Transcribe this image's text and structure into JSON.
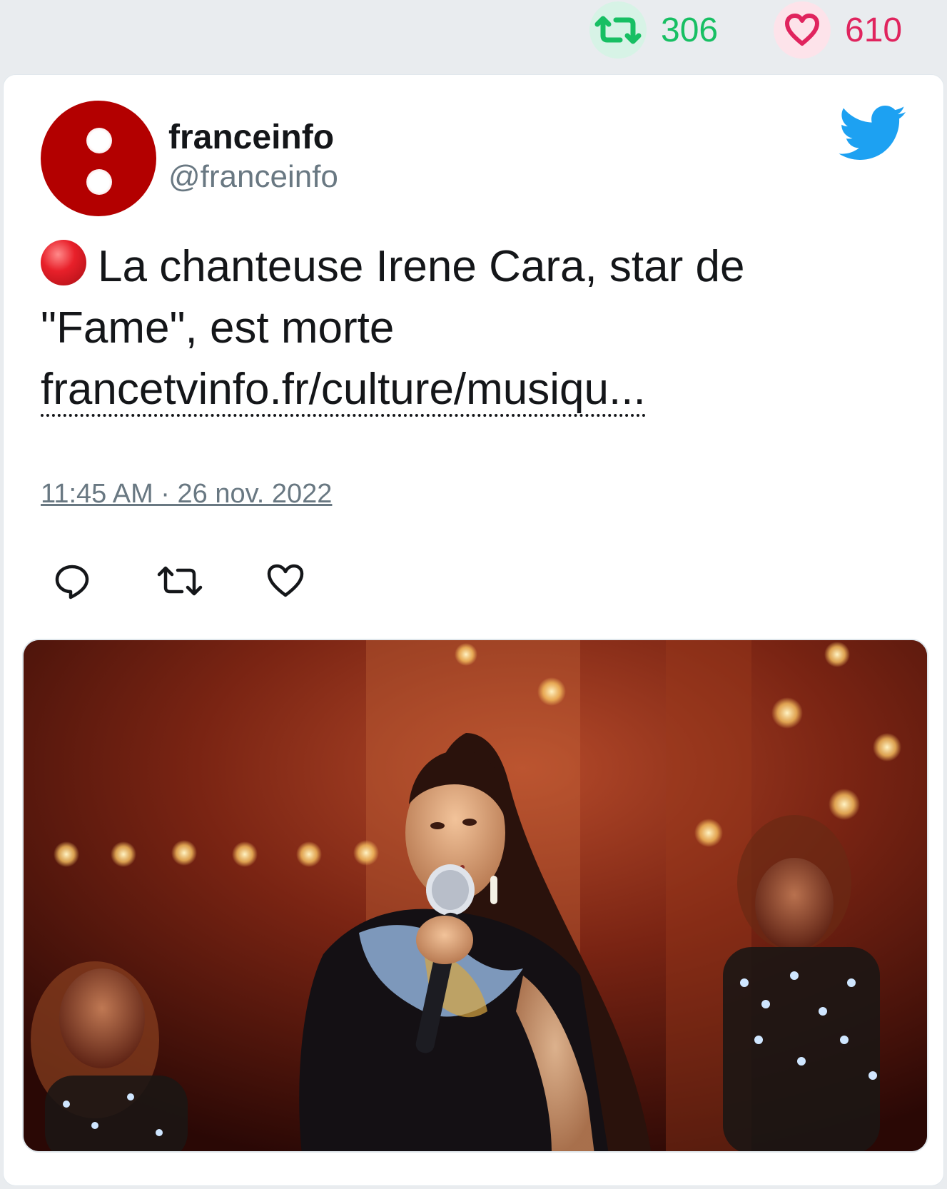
{
  "stats": {
    "retweets": "306",
    "likes": "610"
  },
  "author": {
    "name": "franceinfo",
    "handle": "@franceinfo"
  },
  "tweet": {
    "text": "La chanteuse Irene Cara, star de \"Fame\", est morte",
    "link": "francetvinfo.fr/culture/musiqu...",
    "timestamp": "11:45 AM · 26 nov. 2022"
  },
  "media": {
    "alt": ""
  },
  "colors": {
    "retweet": "#17bf63",
    "like": "#e0245e",
    "twitter_blue": "#1da1f2",
    "avatar_red": "#b30000"
  },
  "icons": [
    "retweet-icon",
    "heart-icon",
    "twitter-bird-icon",
    "reply-icon",
    "live-red-dot-icon"
  ]
}
